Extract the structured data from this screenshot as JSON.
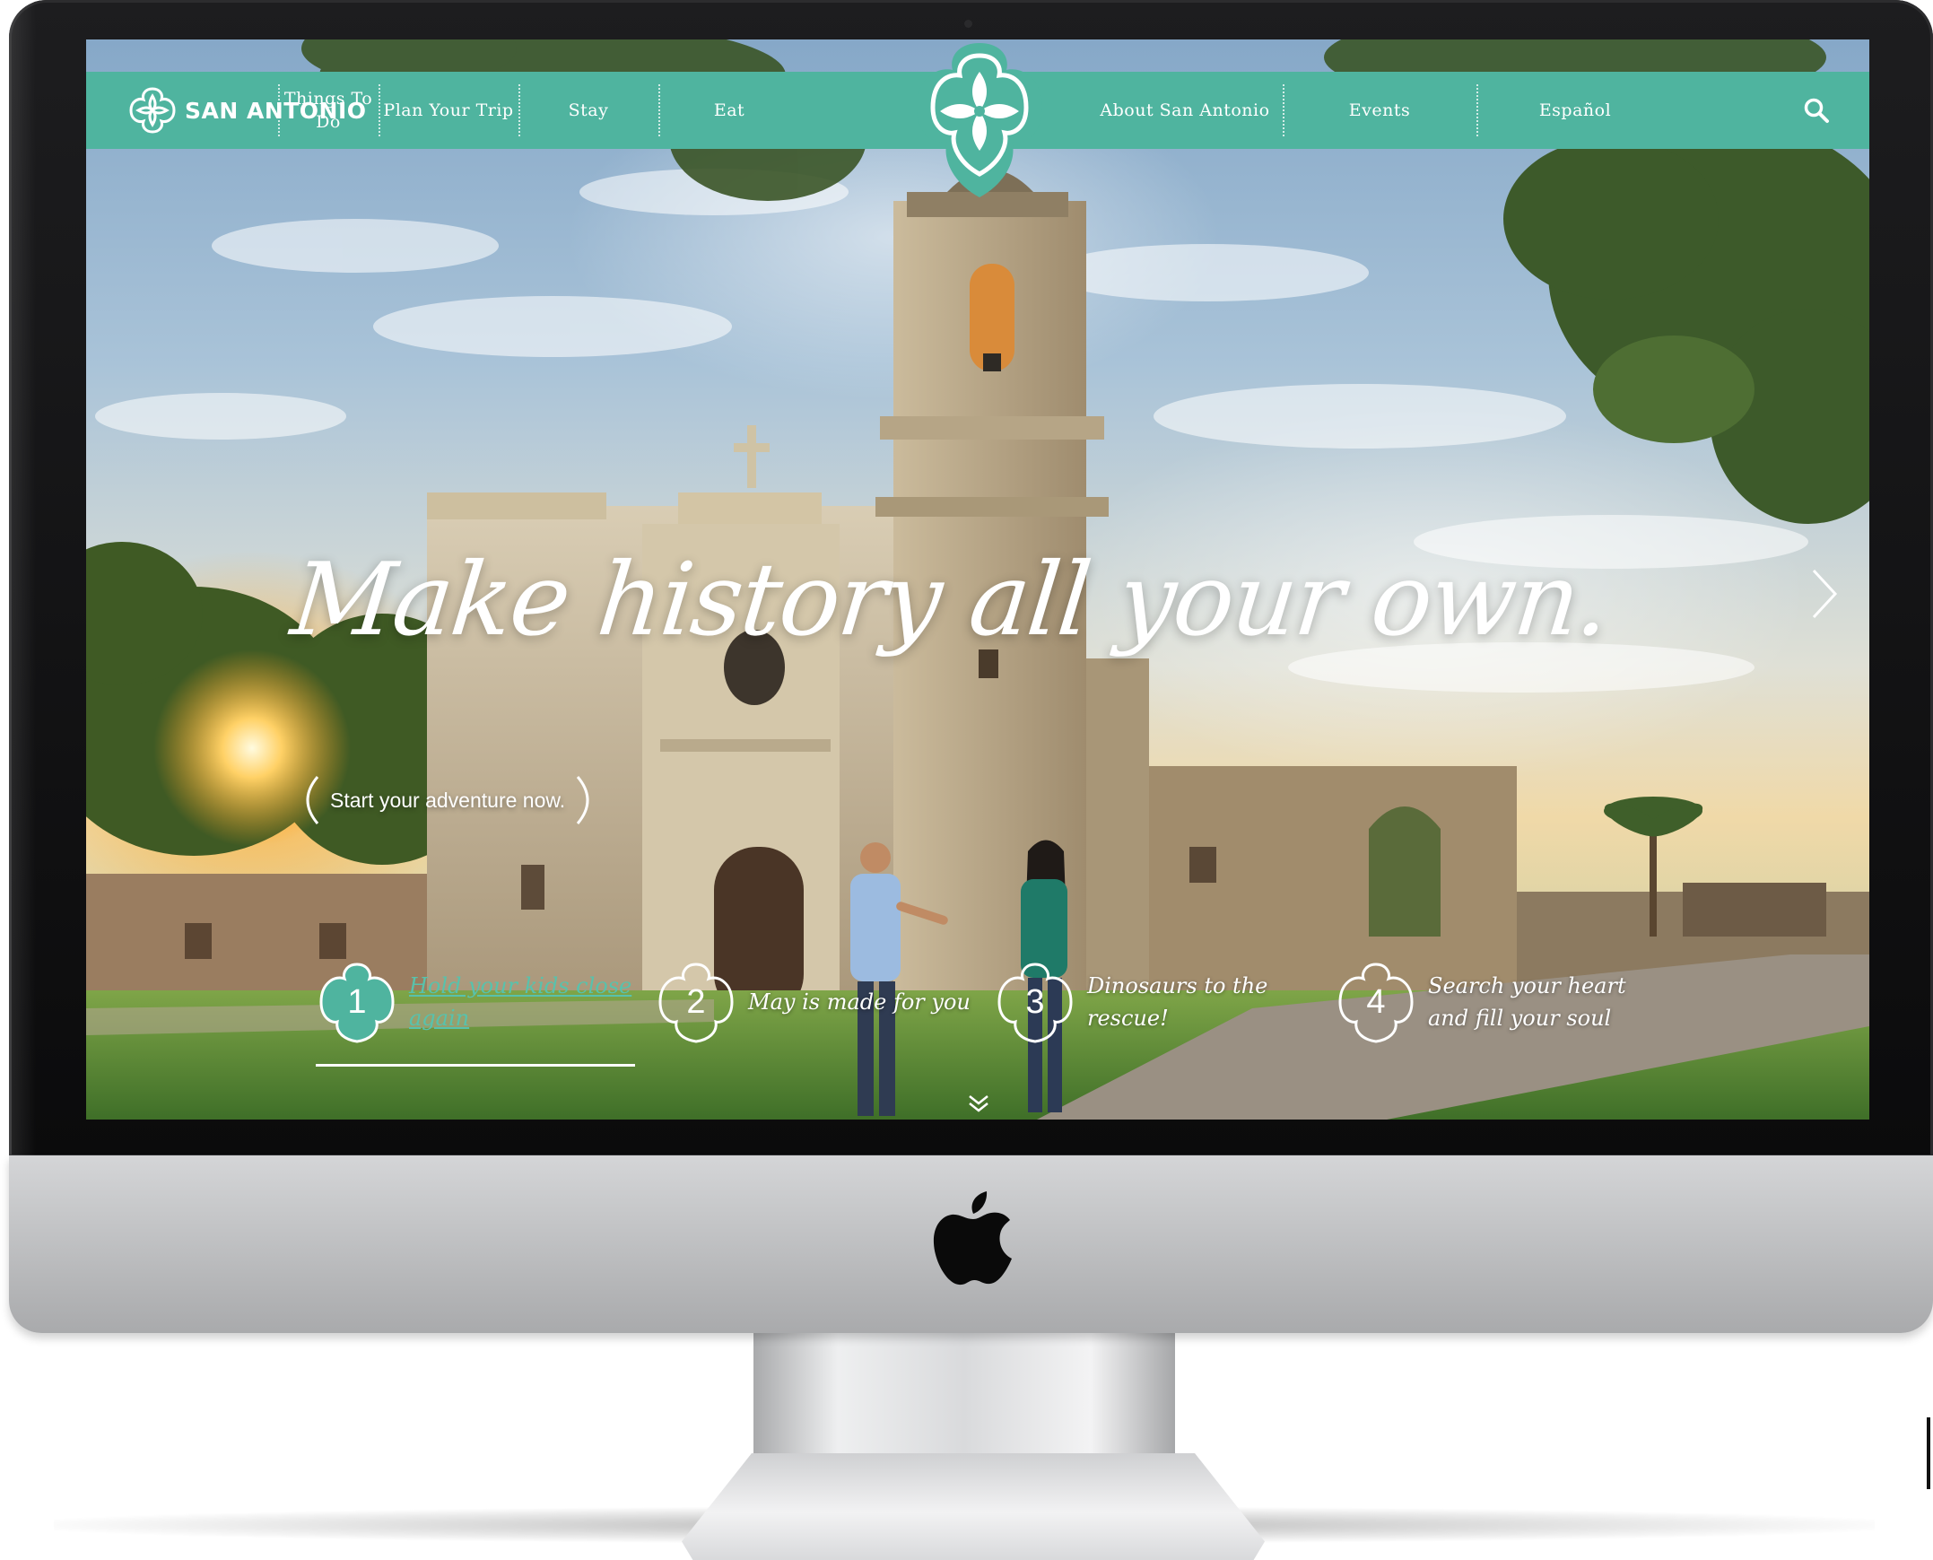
{
  "brand": {
    "name": "SAN ANTONIO",
    "icon": "san-antonio-flower-logo"
  },
  "nav": {
    "items": [
      {
        "label": "Things To Do"
      },
      {
        "label": "Plan Your Trip"
      },
      {
        "label": "Stay"
      },
      {
        "label": "Eat"
      },
      {
        "label": "About San Antonio"
      },
      {
        "label": "Events"
      },
      {
        "label": "Español"
      }
    ],
    "search_icon": "search-icon"
  },
  "hero": {
    "headline": "Make history all your own.",
    "cta": "Start your adventure now.",
    "next_icon": "chevron-right-icon"
  },
  "slides": [
    {
      "number": "1",
      "text": "Hold your kids close again",
      "active": true
    },
    {
      "number": "2",
      "text": "May is made for you",
      "active": false
    },
    {
      "number": "3",
      "text": "Dinosaurs to the rescue!",
      "active": false
    },
    {
      "number": "4",
      "text": "Search your heart and fill your soul",
      "active": false
    }
  ],
  "colors": {
    "accent": "#4fb49f",
    "active_slide_text": "#58c2ac",
    "text": "#ffffff"
  }
}
